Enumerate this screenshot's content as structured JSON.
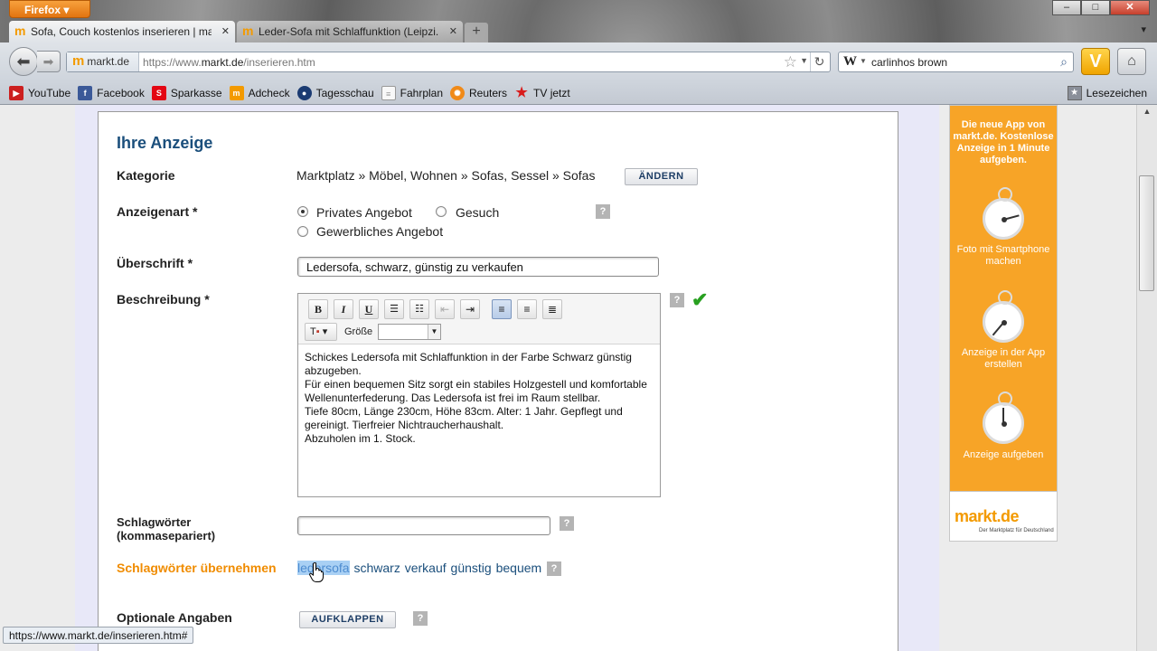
{
  "browser": {
    "app_button": "Firefox",
    "window_controls": [
      "–",
      "□",
      "✕"
    ],
    "tabs": [
      {
        "title": "Sofa, Couch kostenlos inserieren | ma...",
        "active": true
      },
      {
        "title": "Leder-Sofa mit Schlaffunktion (Leipzi...",
        "active": false
      }
    ],
    "new_tab": "+",
    "tab_list": "▾",
    "site_identity": "markt.de",
    "url_prefix": "https://www.",
    "url_domain": "markt.de",
    "url_path": "/inserieren.htm",
    "search_engine": "W",
    "search_text": "carlinhos brown",
    "bookmarks": [
      {
        "label": "YouTube",
        "icon": "youtube-icon",
        "color": "#cc1f1f"
      },
      {
        "label": "Facebook",
        "icon": "facebook-icon",
        "color": "#3b5998"
      },
      {
        "label": "Sparkasse",
        "icon": "sparkasse-icon",
        "color": "#e30613"
      },
      {
        "label": "Adcheck",
        "icon": "markt-icon",
        "color": "#f39a00"
      },
      {
        "label": "Tagesschau",
        "icon": "tagesschau-icon",
        "color": "#1b3b72"
      },
      {
        "label": "Fahrplan",
        "icon": "page-icon",
        "color": "#eeeeee"
      },
      {
        "label": "Reuters",
        "icon": "reuters-icon",
        "color": "#f08a18"
      },
      {
        "label": "TV jetzt",
        "icon": "star-icon",
        "color": "#d91c1c"
      }
    ],
    "bookmarks_menu": "Lesezeichen",
    "status_url": "https://www.markt.de/inserieren.htm#"
  },
  "form": {
    "title": "Ihre Anzeige",
    "category": {
      "label": "Kategorie",
      "value": "Marktplatz » Möbel, Wohnen » Sofas, Sessel » Sofas",
      "change_button": "ÄNDERN"
    },
    "ad_type": {
      "label": "Anzeigenart *",
      "options": [
        "Privates Angebot",
        "Gesuch",
        "Gewerbliches Angebot"
      ],
      "selected": "Privates Angebot"
    },
    "headline": {
      "label": "Überschrift *",
      "value": "Ledersofa, schwarz, günstig zu verkaufen"
    },
    "description": {
      "label": "Beschreibung *",
      "size_label": "Größe",
      "text": "Schickes Ledersofa mit Schlaffunktion in der Farbe Schwarz günstig\nabzugeben.\nFür einen bequemen Sitz sorgt ein stabiles Holzgestell und komfortable\nWellenunterfederung. Das Ledersofa ist frei im Raum stellbar.\nTiefe 80cm, Länge 230cm, Höhe 83cm. Alter: 1 Jahr. Gepflegt und\ngereinigt. Tierfreier Nichtraucherhaushalt.\nAbzuholen im 1. Stock."
    },
    "keywords": {
      "label_line1": "Schlagwörter",
      "label_line2": "(kommasepariert)",
      "value": ""
    },
    "keywords_adopt": {
      "label": "Schlagwörter übernehmen",
      "tags": [
        "ledersofa",
        "schwarz",
        "verkauf",
        "günstig",
        "bequem"
      ]
    },
    "optional": {
      "label": "Optionale Angaben",
      "button": "AUFKLAPPEN"
    },
    "help_glyph": "?"
  },
  "ad": {
    "top_text": "Die neue App von markt.de. Kostenlose Anzeige in 1 Minute aufgeben.",
    "steps": [
      "Foto mit Smartphone machen",
      "Anzeige in der App erstellen",
      "Anzeige aufgeben"
    ],
    "logo": "markt.de",
    "slogan": "Der Marktplatz für Deutschland"
  },
  "colors": {
    "accent_orange": "#f39a00",
    "title_blue": "#1b4f7c",
    "check_green": "#28a020"
  }
}
